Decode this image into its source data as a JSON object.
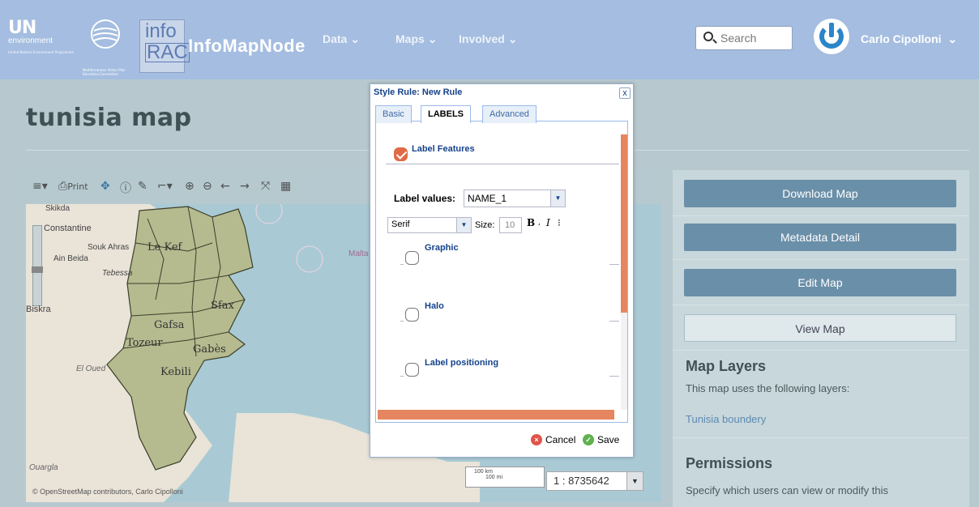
{
  "header": {
    "logo_un": "UN",
    "logo_env": "environment",
    "logo_un_small": "United Nations Environment Programme",
    "logo_map_small": "Mediterranean Action Plan Barcelona Convention",
    "logo_info_top": "info",
    "logo_info_bottom": "RAC",
    "brand": "InfoMapNode",
    "nav": [
      "Data",
      "Maps",
      "Involved"
    ],
    "search_placeholder": "Search",
    "user_name": "Carlo Cipolloni"
  },
  "page": {
    "title": "tunisia map"
  },
  "map": {
    "toolbar": {
      "print_label": "Print"
    },
    "place_labels": [
      "Skikda",
      "Constantine",
      "Souk Ahras",
      "Le Kef",
      "Ain Beida",
      "Tebessa",
      "Biskra",
      "Gafsa",
      "Sfax",
      "Tozeur",
      "Gabès",
      "Kebili",
      "El Oued",
      "Ouargla",
      "Malta"
    ],
    "attribution": "© OpenStreetMap contributors, Carlo Cipolloni",
    "scale_km": "100 km",
    "scale_mi": "100 mi",
    "scale_ratio": "1 : 8735642"
  },
  "dialog": {
    "title": "Style Rule: New Rule",
    "close": "x",
    "tabs": [
      "Basic",
      "LABELS",
      "Advanced"
    ],
    "active_tab": "LABELS",
    "label_features": "Label Features",
    "label_values_label": "Label values:",
    "label_values_value": "NAME_1",
    "font_value": "Serif",
    "size_label": "Size:",
    "size_value": "10",
    "format_bold": "B",
    "format_italic": "I",
    "format_sep": "⁝",
    "graphic": "Graphic",
    "halo": "Halo",
    "label_positioning": "Label positioning",
    "cancel": "Cancel",
    "save": "Save"
  },
  "sidebar": {
    "download_map": "Download Map",
    "metadata_detail": "Metadata Detail",
    "edit_map": "Edit Map",
    "view_map": "View Map",
    "layers_title": "Map Layers",
    "layers_text": "This map uses the following layers:",
    "layer_link": "Tunisia boundery",
    "permissions_title": "Permissions",
    "permissions_text": "Specify which users can view or modify this"
  }
}
